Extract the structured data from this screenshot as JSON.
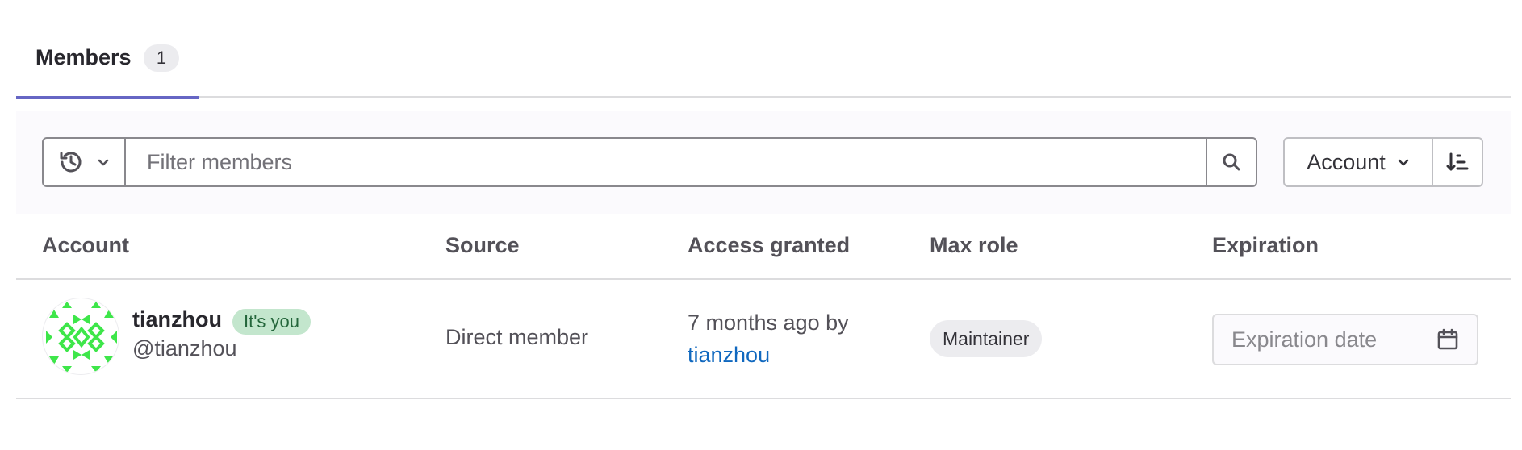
{
  "tabs": {
    "members_label": "Members",
    "members_count": "1"
  },
  "filter": {
    "history_icon": "history-icon",
    "placeholder": "Filter members",
    "search_icon": "search-icon"
  },
  "sort": {
    "selected": "Account",
    "direction_icon": "sort-lowest-icon"
  },
  "table": {
    "headers": [
      "Account",
      "Source",
      "Access granted",
      "Max role",
      "Expiration"
    ],
    "rows": [
      {
        "name": "tianzhou",
        "badge": "It's you",
        "handle": "@tianzhou",
        "source": "Direct member",
        "access_granted": "7 months ago by",
        "granted_by": "tianzhou",
        "max_role": "Maintainer",
        "expiration_placeholder": "Expiration date"
      }
    ]
  },
  "colors": {
    "tab_underline": "#6666c4",
    "link": "#1068bf",
    "you_badge_bg": "#c3e6cd",
    "you_badge_text": "#24663b",
    "avatar_identicon": "#3ee64a"
  }
}
